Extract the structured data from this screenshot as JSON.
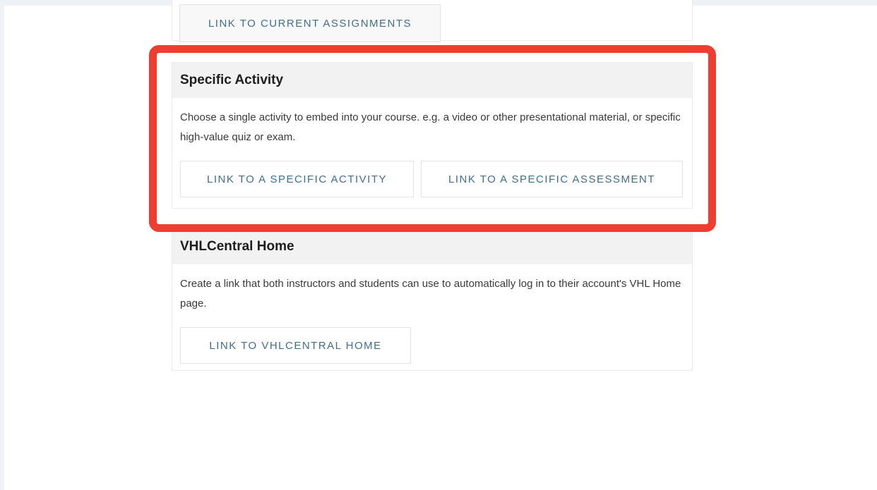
{
  "top_partial": {
    "button_label": "LINK TO CURRENT ASSIGNMENTS"
  },
  "specific_activity": {
    "title": "Specific Activity",
    "description": "Choose a single activity to embed into your course. e.g. a video or other presentational material, or specific high-value quiz or exam.",
    "button_activity": "LINK TO A SPECIFIC ACTIVITY",
    "button_assessment": "LINK TO A SPECIFIC ASSESSMENT"
  },
  "vhl_home": {
    "title": "VHLCentral Home",
    "description": "Create a link that both instructors and students can use to automatically log in to their account's VHL Home page.",
    "button_home": "LINK TO VHLCENTRAL HOME"
  },
  "colors": {
    "highlight": "#ee3d31",
    "link_text": "#3f6f8b",
    "header_bg": "#f2f2f2"
  }
}
